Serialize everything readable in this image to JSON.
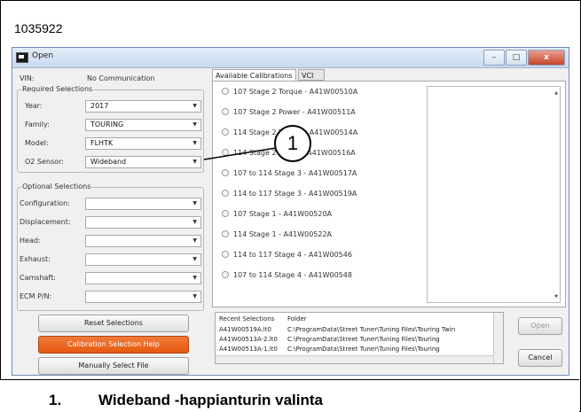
{
  "figure_id": "1035922",
  "window": {
    "title": "Open",
    "buttons": {
      "minimize": "–",
      "maximize": "□",
      "close": "x"
    }
  },
  "vin": {
    "label": "VIN:",
    "value": "No Communication"
  },
  "required": {
    "title": "Required Selections",
    "fields": [
      {
        "label": "Year:",
        "value": "2017"
      },
      {
        "label": "Family:",
        "value": "TOURING"
      },
      {
        "label": "Model:",
        "value": "FLHTK"
      },
      {
        "label": "O2 Sensor:",
        "value": "Wideband"
      }
    ]
  },
  "optional": {
    "title": "Optional Selections",
    "fields": [
      {
        "label": "Configuration:",
        "value": ""
      },
      {
        "label": "Displacement:",
        "value": ""
      },
      {
        "label": "Head:",
        "value": ""
      },
      {
        "label": "Exhaust:",
        "value": ""
      },
      {
        "label": "Camshaft:",
        "value": ""
      },
      {
        "label": "ECM P/N:",
        "value": ""
      }
    ]
  },
  "buttons": {
    "reset": "Reset Selections",
    "help": "Calibration Selection Help",
    "manual": "Manually Select File",
    "open": "Open",
    "cancel": "Cancel"
  },
  "tabs": [
    "Available Calibrations",
    "VCI"
  ],
  "calibrations": [
    "107 Stage 2 Torque - A41W00510A",
    "107 Stage 2 Power - A41W00511A",
    "114 Stage 2 Torque - A41W00514A",
    "114 Stage 2 Power - A41W00516A",
    "107 to 114 Stage 3 - A41W00517A",
    "114 to 117 Stage 3 - A41W00519A",
    "107 Stage 1 - A41W00520A",
    "114 Stage 1 - A41W00522A",
    "114 to 117 Stage 4 - A41W00546",
    "107 to 114 Stage 4 - A41W00548"
  ],
  "recent": {
    "headers": [
      "Recent Selections",
      "Folder"
    ],
    "rows": [
      {
        "file": "A41W00519A.lt0",
        "folder": "C:\\ProgramData\\Street Tuner\\Tuning Files\\Touring Twin"
      },
      {
        "file": "A41W00513A-2.lt0",
        "folder": "C:\\ProgramData\\Street Tuner\\Tuning Files\\Touring"
      },
      {
        "file": "A41W00513A-1.lt0",
        "folder": "C:\\ProgramData\\Street Tuner\\Tuning Files\\Touring"
      }
    ]
  },
  "callout": {
    "number": "1"
  },
  "caption": {
    "number": "1.",
    "text": "Wideband -happianturin valinta"
  }
}
